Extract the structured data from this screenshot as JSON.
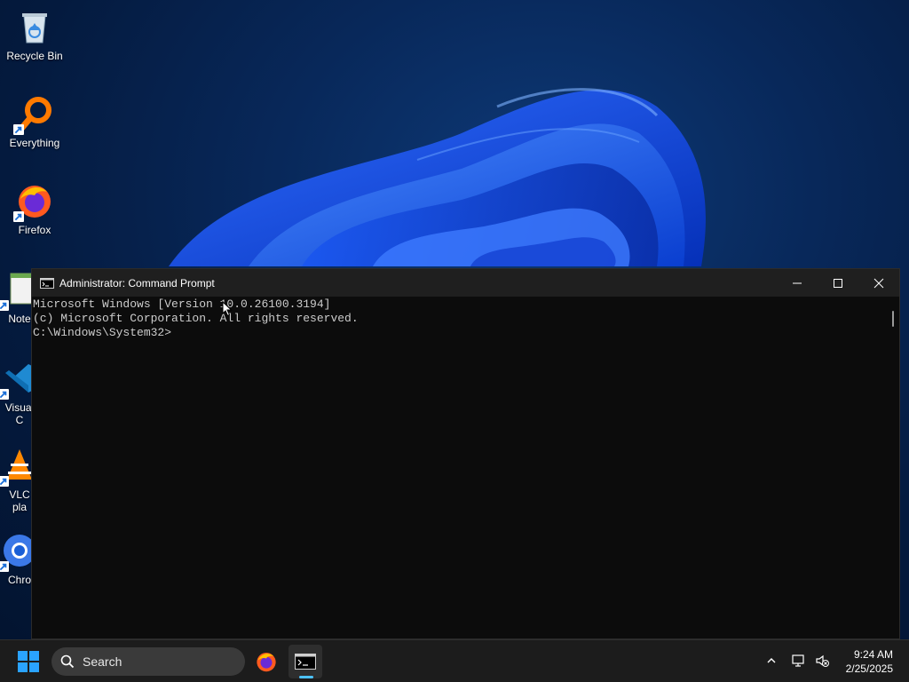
{
  "desktop": {
    "icons": [
      {
        "label": "Recycle Bin",
        "icon": "recycle-bin-icon"
      },
      {
        "label": "Everything",
        "icon": "everything-search-icon"
      },
      {
        "label": "Firefox",
        "icon": "firefox-icon"
      },
      {
        "label": "Note",
        "icon": "notepad-icon"
      },
      {
        "label": "Visual",
        "label2": "C",
        "icon": "vscode-icon"
      },
      {
        "label": "VLC",
        "label2": "pla",
        "icon": "vlc-icon"
      },
      {
        "label": "Chro",
        "icon": "chrome-icon"
      }
    ]
  },
  "window": {
    "title": "Administrator: Command Prompt",
    "console_lines": [
      "Microsoft Windows [Version 10.0.26100.3194]",
      "(c) Microsoft Corporation. All rights reserved.",
      "",
      "C:\\Windows\\System32>"
    ],
    "background": "#0c0c0c",
    "text_color": "#cccccc"
  },
  "taskbar": {
    "search_label": "Search",
    "apps": [
      {
        "name": "firefox",
        "icon": "firefox-icon"
      },
      {
        "name": "command-prompt",
        "icon": "cmd-icon",
        "active": true
      }
    ],
    "clock": {
      "time": "9:24 AM",
      "date": "2/25/2025"
    },
    "accent": "#4cc2ff"
  }
}
